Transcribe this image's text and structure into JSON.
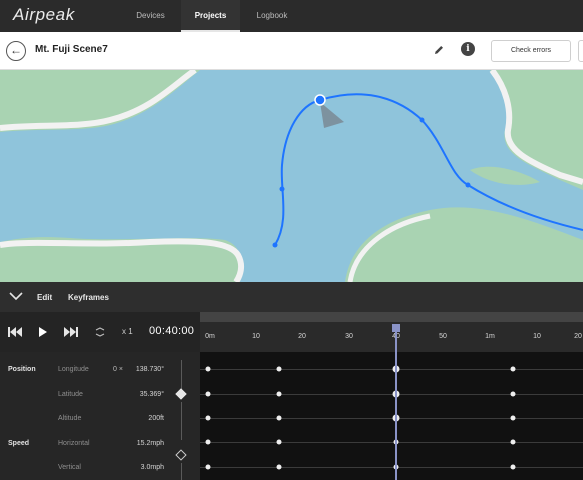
{
  "app": {
    "logo": "Airpeak"
  },
  "nav": {
    "tabs": [
      {
        "label": "Devices",
        "active": false
      },
      {
        "label": "Projects",
        "active": true
      },
      {
        "label": "Logbook",
        "active": false
      }
    ]
  },
  "titlebar": {
    "back_icon": "arrow-left-icon",
    "title": "Mt. Fuji Scene7",
    "edit_icon": "pencil-icon",
    "info_icon": "info-icon",
    "info_glyph": "i",
    "check_errors_label": "Check errors"
  },
  "map": {
    "water_color": "#8fc4db",
    "land_color": "#a9d3b2",
    "road_color": "#f2f2f2",
    "path_color": "#1e74ff",
    "drone_icon": "drone-heading-icon"
  },
  "panel": {
    "collapse_icon": "chevron-down-icon",
    "edit_label": "Edit",
    "keyframes_label": "Keyframes"
  },
  "playback": {
    "skip_back_icon": "skip-back-icon",
    "play_icon": "play-icon",
    "skip_forward_icon": "skip-forward-icon",
    "loop_icon": "loop-icon",
    "speed": "x 1",
    "time": "00:40:00"
  },
  "params": {
    "groups": {
      "position": "Position",
      "speed": "Speed"
    },
    "rows": [
      {
        "name": "Longitude",
        "value": "138.730°",
        "prefix": "0 ×"
      },
      {
        "name": "Latitude",
        "value": "35.369°"
      },
      {
        "name": "Altitude",
        "value": "200ft"
      },
      {
        "name": "Horizontal",
        "value": "15.2mph"
      },
      {
        "name": "Vertical",
        "value": "3.0mph"
      }
    ]
  },
  "timeline": {
    "ticks": [
      "0m",
      "10",
      "20",
      "30",
      "40",
      "50",
      "1m",
      "10",
      "20"
    ],
    "playhead_label": "40"
  }
}
